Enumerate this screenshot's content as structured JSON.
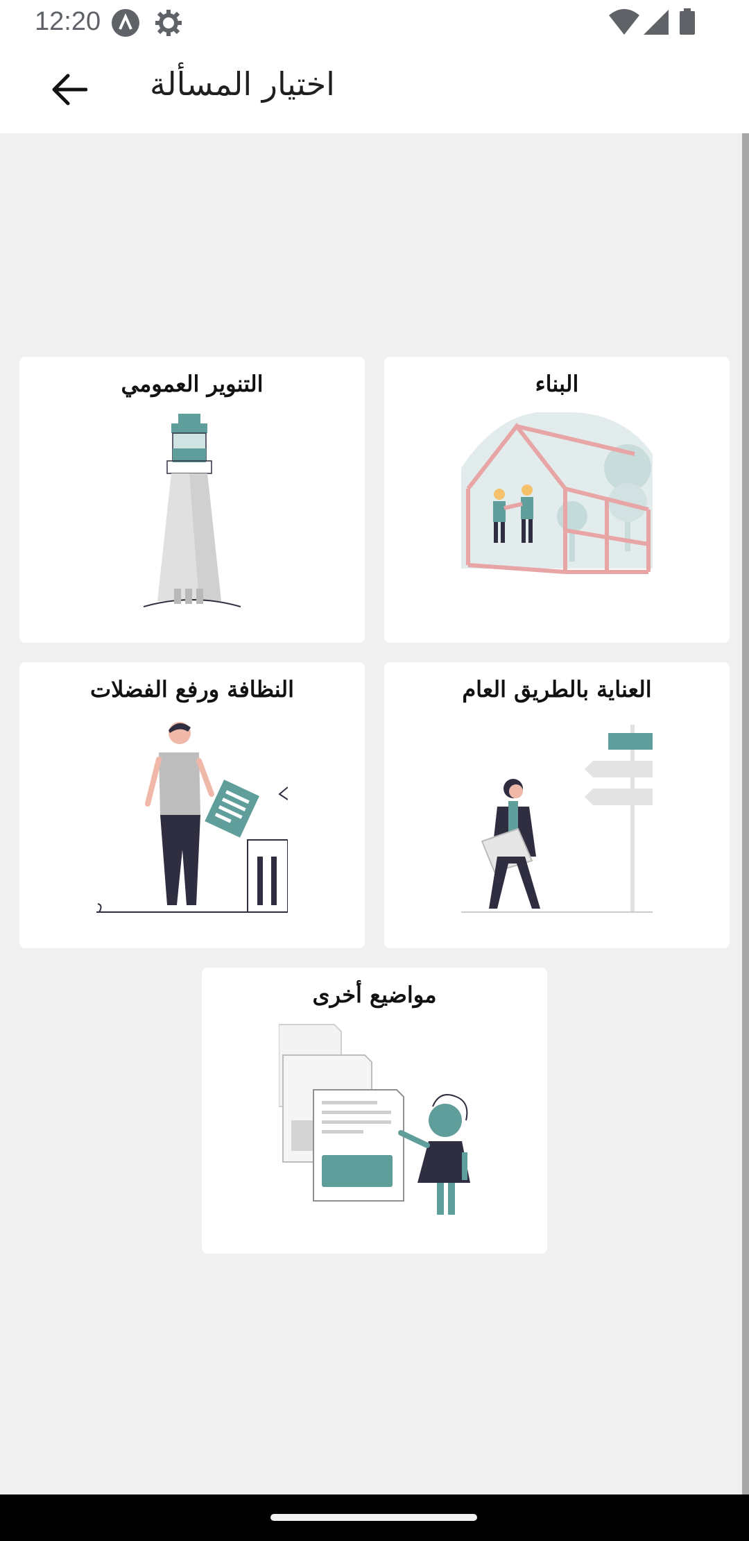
{
  "status": {
    "time": "12:20"
  },
  "header": {
    "title": "اختيار المسألة"
  },
  "categories": [
    {
      "label": "البناء",
      "icon": "construction-illustration"
    },
    {
      "label": "التنوير العمومي",
      "icon": "lighthouse-illustration"
    },
    {
      "label": "العناية بالطريق العام",
      "icon": "road-sign-illustration"
    },
    {
      "label": "النظافة ورفع الفضلات",
      "icon": "waste-illustration"
    },
    {
      "label": "مواضيع أخرى",
      "icon": "documents-illustration"
    }
  ],
  "colors": {
    "accent": "#5f9e9a",
    "dark": "#2f2e41",
    "pink": "#e8a5a5",
    "background": "#f0f0f0"
  }
}
